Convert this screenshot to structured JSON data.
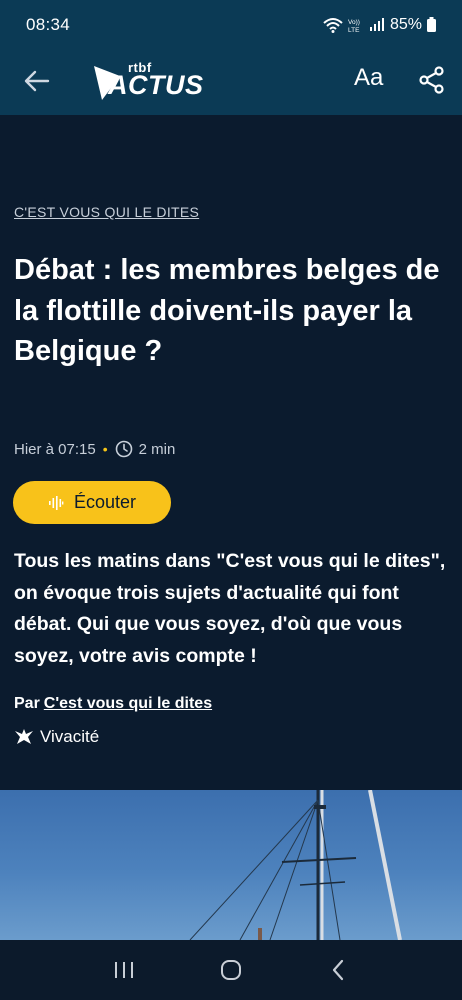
{
  "status_bar": {
    "time": "08:34",
    "network": "VoLTE",
    "battery": "85%"
  },
  "app_bar": {
    "logo_small": "rtbf",
    "logo_main": "ACTUS",
    "font_size_label": "Aa",
    "icons": [
      "back-arrow-icon",
      "share-icon"
    ]
  },
  "article": {
    "rubric": "C'EST VOUS QUI LE DITES",
    "title": "Débat : les membres belges de la flottille doivent-ils payer la Belgique ?",
    "published": "Hier à 07:15",
    "reading_time": "2 min",
    "listen_label": "Écouter",
    "intro": "Tous les matins dans \"C'est vous qui le dites\", on évoque trois sujets d'actualité qui font débat. Qui que vous soyez, d'où que vous soyez, votre avis compte !",
    "byline_prefix": "Par",
    "author": "C'est vous qui le dites",
    "station": "Vivacité"
  },
  "colors": {
    "header_bg": "#0b3a55",
    "page_bg": "#0b1b2e",
    "accent_yellow": "#f8c21a"
  },
  "nav_bar": {
    "icons": [
      "recents-icon",
      "home-icon",
      "back-icon"
    ]
  }
}
